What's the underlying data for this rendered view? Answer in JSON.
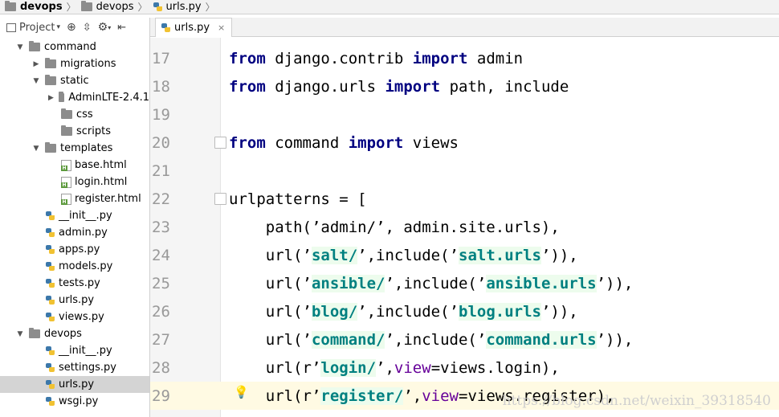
{
  "breadcrumb": {
    "project": "devops",
    "folder": "devops",
    "file": "urls.py"
  },
  "project_toolbar": {
    "view_label": "Project",
    "view_chevron": "▾"
  },
  "tree": [
    {
      "label": "command",
      "type": "folder",
      "arrow": "▼",
      "indent": 1
    },
    {
      "label": "migrations",
      "type": "folder",
      "arrow": "▶",
      "indent": 2
    },
    {
      "label": "static",
      "type": "folder",
      "arrow": "▼",
      "indent": 2
    },
    {
      "label": "AdminLTE-2.4.1",
      "type": "folder",
      "arrow": "▶",
      "indent": 3
    },
    {
      "label": "css",
      "type": "folder",
      "arrow": "",
      "indent": 3
    },
    {
      "label": "scripts",
      "type": "folder",
      "arrow": "",
      "indent": 3
    },
    {
      "label": "templates",
      "type": "folder",
      "arrow": "▼",
      "indent": 2
    },
    {
      "label": "base.html",
      "type": "html",
      "arrow": "",
      "indent": 3
    },
    {
      "label": "login.html",
      "type": "html",
      "arrow": "",
      "indent": 3
    },
    {
      "label": "register.html",
      "type": "html",
      "arrow": "",
      "indent": 3
    },
    {
      "label": "__init__.py",
      "type": "py",
      "arrow": "",
      "indent": 2
    },
    {
      "label": "admin.py",
      "type": "py",
      "arrow": "",
      "indent": 2
    },
    {
      "label": "apps.py",
      "type": "py",
      "arrow": "",
      "indent": 2
    },
    {
      "label": "models.py",
      "type": "py",
      "arrow": "",
      "indent": 2
    },
    {
      "label": "tests.py",
      "type": "py",
      "arrow": "",
      "indent": 2
    },
    {
      "label": "urls.py",
      "type": "py",
      "arrow": "",
      "indent": 2
    },
    {
      "label": "views.py",
      "type": "py",
      "arrow": "",
      "indent": 2
    },
    {
      "label": "devops",
      "type": "folder",
      "arrow": "▼",
      "indent": 1
    },
    {
      "label": "__init__.py",
      "type": "py",
      "arrow": "",
      "indent": 2
    },
    {
      "label": "settings.py",
      "type": "py",
      "arrow": "",
      "indent": 2
    },
    {
      "label": "urls.py",
      "type": "py",
      "arrow": "",
      "indent": 2,
      "selected": true
    },
    {
      "label": "wsgi.py",
      "type": "py",
      "arrow": "",
      "indent": 2
    }
  ],
  "editor_tab": {
    "label": "urls.py",
    "close": "×"
  },
  "code_lines": [
    {
      "no": "17",
      "tokens": [
        [
          "kw",
          "from"
        ],
        [
          "t",
          " django.contrib "
        ],
        [
          "kw",
          "import"
        ],
        [
          "t",
          " admin"
        ]
      ]
    },
    {
      "no": "18",
      "tokens": [
        [
          "kw",
          "from"
        ],
        [
          "t",
          " django.urls "
        ],
        [
          "kw",
          "import"
        ],
        [
          "t",
          " path, include"
        ]
      ]
    },
    {
      "no": "19",
      "tokens": []
    },
    {
      "no": "20",
      "tokens": [
        [
          "kw",
          "from"
        ],
        [
          "t",
          " command "
        ],
        [
          "kw",
          "import"
        ],
        [
          "t",
          " views"
        ]
      ],
      "fold": true
    },
    {
      "no": "21",
      "tokens": []
    },
    {
      "no": "22",
      "tokens": [
        [
          "t",
          "urlpatterns = ["
        ]
      ],
      "fold": true
    },
    {
      "no": "23",
      "tokens": [
        [
          "t",
          "    path('admin/', admin.site.urls),"
        ]
      ]
    },
    {
      "no": "24",
      "tokens": [
        [
          "t",
          "    url('"
        ],
        [
          "str",
          "salt/"
        ],
        [
          "t",
          "',include('"
        ],
        [
          "str",
          "salt.urls"
        ],
        [
          "t",
          "')),"
        ]
      ]
    },
    {
      "no": "25",
      "tokens": [
        [
          "t",
          "    url('"
        ],
        [
          "str",
          "ansible/"
        ],
        [
          "t",
          "',include('"
        ],
        [
          "str",
          "ansible.urls"
        ],
        [
          "t",
          "')),"
        ]
      ]
    },
    {
      "no": "26",
      "tokens": [
        [
          "t",
          "    url('"
        ],
        [
          "str",
          "blog/"
        ],
        [
          "t",
          "',include('"
        ],
        [
          "str",
          "blog.urls"
        ],
        [
          "t",
          "')),"
        ]
      ]
    },
    {
      "no": "27",
      "tokens": [
        [
          "t",
          "    url('"
        ],
        [
          "str",
          "command/"
        ],
        [
          "t",
          "',include('"
        ],
        [
          "str",
          "command.urls"
        ],
        [
          "t",
          "')),"
        ]
      ]
    },
    {
      "no": "28",
      "tokens": [
        [
          "t",
          "    url(r'"
        ],
        [
          "str",
          "login/"
        ],
        [
          "t",
          "',"
        ],
        [
          "kwarg",
          "view"
        ],
        [
          "t",
          "=views.login),"
        ]
      ]
    },
    {
      "no": "29",
      "tokens": [
        [
          "t",
          "    url(r'"
        ],
        [
          "str",
          "register/"
        ],
        [
          "t",
          "',"
        ],
        [
          "kwarg",
          "view"
        ],
        [
          "t",
          "=views.register),"
        ]
      ],
      "current": true,
      "bulb": true
    }
  ],
  "bulb_glyph": "💡",
  "watermark": "https://blog.csdn.net/weixin_39318540",
  "colors": {
    "keyword": "#000080",
    "string": "#008080",
    "kwarg": "#660099",
    "current_line": "#fffae3"
  }
}
